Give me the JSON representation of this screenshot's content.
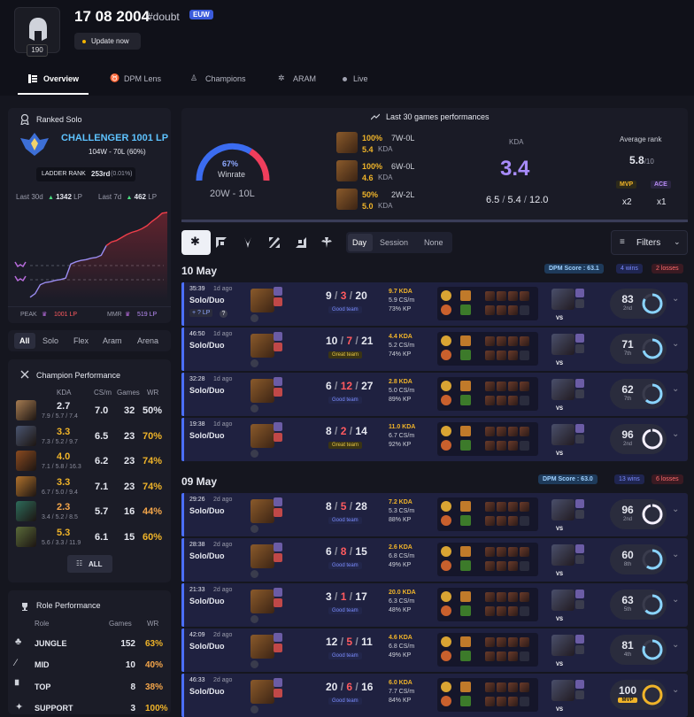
{
  "profile": {
    "name": "17 08 2004",
    "tag": "#doubt",
    "region": "EUW",
    "level": "190",
    "update_label": "Update now"
  },
  "tabs": [
    {
      "label": "Overview"
    },
    {
      "label": "DPM Lens"
    },
    {
      "label": "Champions"
    },
    {
      "label": "ARAM"
    },
    {
      "label": "Live"
    }
  ],
  "ranked": {
    "title": "Ranked Solo",
    "tier": "CHALLENGER 1001 LP",
    "record": "104W - 70L (60%)",
    "ladder_label": "LADDER RANK",
    "ladder_value": "253rd",
    "ladder_pct": "(0.01%)",
    "last30_label": "Last 30d",
    "last30_value": "1342",
    "last7_label": "Last 7d",
    "last7_value": "462",
    "lp_unit": "LP",
    "peak_label": "PEAK",
    "peak_value": "1001 LP",
    "mmr_label": "MMR",
    "mmr_value": "519 LP"
  },
  "queue_filters": [
    "All",
    "Solo",
    "Flex",
    "Aram",
    "Arena"
  ],
  "champ_perf": {
    "title": "Champion Performance",
    "headers": {
      "kda": "KDA",
      "cs": "CS/m",
      "games": "Games",
      "wr": "WR"
    },
    "rows": [
      {
        "kda": "2.7",
        "sub": "7.9 / 5.7 / 7.4",
        "cs": "7.0",
        "games": "32",
        "wr": "50%",
        "color": "#e6e8f0"
      },
      {
        "kda": "3.3",
        "sub": "7.3 / 5.2 / 9.7",
        "cs": "6.5",
        "games": "23",
        "wr": "70%",
        "color": "#f0b429"
      },
      {
        "kda": "4.0",
        "sub": "7.1 / 5.8 / 16.3",
        "cs": "6.2",
        "games": "23",
        "wr": "74%",
        "color": "#f0b429"
      },
      {
        "kda": "3.3",
        "sub": "6.7 / 5.0 / 9.4",
        "cs": "7.1",
        "games": "23",
        "wr": "74%",
        "color": "#f0b429"
      },
      {
        "kda": "2.3",
        "sub": "3.4 / 5.2 / 8.5",
        "cs": "5.7",
        "games": "16",
        "wr": "44%",
        "color": "#f5a64a"
      },
      {
        "kda": "5.3",
        "sub": "5.6 / 3.3 / 11.9",
        "cs": "6.1",
        "games": "15",
        "wr": "60%",
        "color": "#f0b429"
      }
    ],
    "all_label": "ALL"
  },
  "role_perf": {
    "title": "Role Performance",
    "headers": {
      "role": "Role",
      "games": "Games",
      "wr": "WR"
    },
    "rows": [
      {
        "role": "JUNGLE",
        "games": "152",
        "wr": "63%",
        "color": "#f0b429"
      },
      {
        "role": "MID",
        "games": "10",
        "wr": "40%",
        "color": "#f5a64a"
      },
      {
        "role": "TOP",
        "games": "8",
        "wr": "38%",
        "color": "#f5a64a"
      },
      {
        "role": "SUPPORT",
        "games": "3",
        "wr": "100%",
        "color": "#f0b429"
      }
    ]
  },
  "summary": {
    "title": "Last 30 games performances",
    "winrate_pct": "67%",
    "winrate_label": "Winrate",
    "record": "20W - 10L",
    "champs": [
      {
        "pct": "100%",
        "record": "7W-0L",
        "kda": "5.4",
        "kda_label": "KDA"
      },
      {
        "pct": "100%",
        "record": "6W-0L",
        "kda": "4.6",
        "kda_label": "KDA"
      },
      {
        "pct": "50%",
        "record": "2W-2L",
        "kda": "5.0",
        "kda_label": "KDA"
      }
    ],
    "kda_label": "KDA",
    "kda_value": "3.4",
    "kda_k": "6.5",
    "kda_d": "5.4",
    "kda_a": "12.0",
    "avg_rank_label": "Average rank",
    "avg_rank_value": "5.8",
    "avg_rank_of": "/10",
    "mvp_label": "MVP",
    "mvp_count": "x2",
    "ace_label": "ACE",
    "ace_count": "x1"
  },
  "filters": {
    "time_tabs": [
      "Day",
      "Session",
      "None"
    ],
    "filters_label": "Filters"
  },
  "days": [
    {
      "date": "10 May",
      "dpm": "DPM Score : 63.1",
      "wins": "4 wins",
      "losses": "2 losses"
    },
    {
      "date": "09 May",
      "dpm": "DPM Score : 63.0",
      "wins": "13 wins",
      "losses": "6 losses"
    }
  ],
  "matches": [
    {
      "time": "35:39",
      "ago": "1d ago",
      "queue": "Solo/Duo",
      "k": "9",
      "d": "3",
      "a": "20",
      "badge": "Good team",
      "kda": "9.7 KDA",
      "cs": "5.9 CS/m",
      "kp": "73% KP",
      "score": "83",
      "place": "2nd",
      "lp": "+ ? LP"
    },
    {
      "time": "46:50",
      "ago": "1d ago",
      "queue": "Solo/Duo",
      "k": "10",
      "d": "7",
      "a": "21",
      "badge": "Great team",
      "kda": "4.4 KDA",
      "cs": "5.2 CS/m",
      "kp": "74% KP",
      "score": "71",
      "place": "7th"
    },
    {
      "time": "32:28",
      "ago": "1d ago",
      "queue": "Solo/Duo",
      "k": "6",
      "d": "12",
      "a": "27",
      "badge": "Good team",
      "kda": "2.8 KDA",
      "cs": "5.0 CS/m",
      "kp": "89% KP",
      "score": "62",
      "place": "7th"
    },
    {
      "time": "19:38",
      "ago": "1d ago",
      "queue": "Solo/Duo",
      "k": "8",
      "d": "2",
      "a": "14",
      "badge": "Great team",
      "kda": "11.0 KDA",
      "cs": "6.7 CS/m",
      "kp": "92% KP",
      "score": "96",
      "place": "2nd"
    },
    {
      "time": "29:26",
      "ago": "2d ago",
      "queue": "Solo/Duo",
      "k": "8",
      "d": "5",
      "a": "28",
      "badge": "Good team",
      "kda": "7.2 KDA",
      "cs": "5.3 CS/m",
      "kp": "88% KP",
      "score": "96",
      "place": "2nd"
    },
    {
      "time": "28:38",
      "ago": "2d ago",
      "queue": "Solo/Duo",
      "k": "6",
      "d": "8",
      "a": "15",
      "badge": "Good team",
      "kda": "2.6 KDA",
      "cs": "6.8 CS/m",
      "kp": "49% KP",
      "score": "60",
      "place": "8th"
    },
    {
      "time": "21:33",
      "ago": "2d ago",
      "queue": "Solo/Duo",
      "k": "3",
      "d": "1",
      "a": "17",
      "badge": "Good team",
      "kda": "20.0 KDA",
      "cs": "6.3 CS/m",
      "kp": "48% KP",
      "score": "63",
      "place": "5th"
    },
    {
      "time": "42:09",
      "ago": "2d ago",
      "queue": "Solo/Duo",
      "k": "12",
      "d": "5",
      "a": "11",
      "badge": "Good team",
      "kda": "4.6 KDA",
      "cs": "6.8 CS/m",
      "kp": "49% KP",
      "score": "81",
      "place": "4th"
    },
    {
      "time": "46:33",
      "ago": "2d ago",
      "queue": "Solo/Duo",
      "k": "20",
      "d": "6",
      "a": "16",
      "badge": "Good team",
      "kda": "6.0 KDA",
      "cs": "7.7 CS/m",
      "kp": "84% KP",
      "score": "100",
      "place": "MVP"
    }
  ],
  "vs_label": "VS",
  "chart_data": {
    "type": "line",
    "series": [
      {
        "values": [
          -0.15,
          -0.1,
          0.02,
          0.05,
          0.06,
          0.08,
          0.09,
          0.11,
          0.3,
          0.33,
          0.35,
          0.36,
          0.38,
          0.39,
          0.42,
          0.55,
          0.6,
          0.62,
          0.66,
          0.7,
          0.73,
          0.75,
          0.78,
          0.82,
          0.88,
          0.93,
          0.99,
          1.0
        ]
      }
    ]
  }
}
